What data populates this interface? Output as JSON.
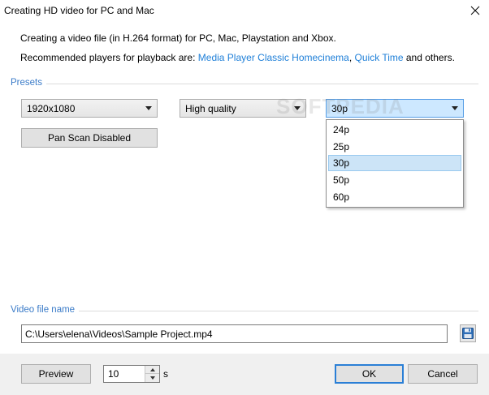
{
  "window": {
    "title": "Creating HD video for PC and Mac",
    "close_icon": "close-icon"
  },
  "info": {
    "line1": "Creating a video file (in H.264 format) for PC, Mac, Playstation and Xbox.",
    "line2_prefix": "Recommended players for playback are: ",
    "link1": "Media Player Classic Homecinema",
    "separator": ", ",
    "link2": "Quick Time",
    "line2_suffix": " and others.",
    "link_color": "#1e7fd8"
  },
  "presets": {
    "label": "Presets",
    "resolution": "1920x1080",
    "quality": "High quality",
    "framerate": "30p",
    "framerate_options": [
      "24p",
      "25p",
      "30p",
      "50p",
      "60p"
    ],
    "selected_index": 2,
    "pan_scan_label": "Pan  Scan Disabled"
  },
  "watermark": "SOFTPEDIA",
  "video_file": {
    "label": "Video file name",
    "path": "C:\\Users\\elena\\Videos\\Sample Project.mp4",
    "save_icon": "floppy-disk-icon"
  },
  "footer": {
    "preview_label": "Preview",
    "duration_value": "10",
    "duration_unit": "s",
    "ok_label": "OK",
    "cancel_label": "Cancel"
  }
}
